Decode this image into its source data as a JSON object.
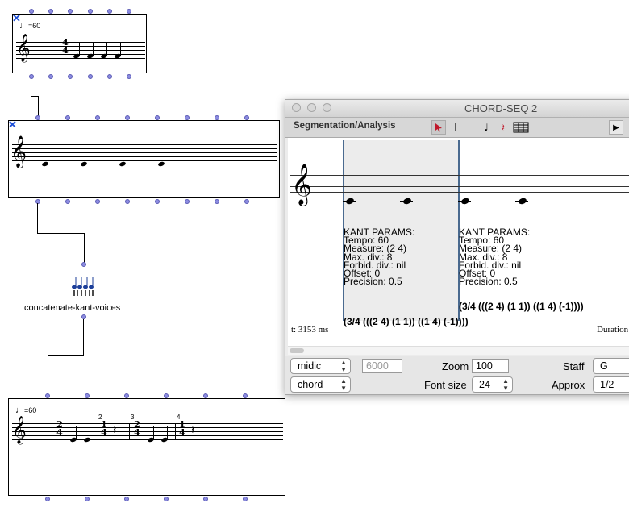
{
  "box1": {
    "tempo_label": "=60",
    "time_sig_top": "4",
    "time_sig_bottom": "4"
  },
  "box4": {
    "tempo_label": "=60",
    "measures": [
      {
        "number": "",
        "top": "2",
        "bottom": "4"
      },
      {
        "number": "2",
        "top": "1",
        "bottom": "4"
      },
      {
        "number": "3",
        "top": "2",
        "bottom": "4"
      },
      {
        "number": "4",
        "top": "1",
        "bottom": "4"
      }
    ]
  },
  "concat_box": {
    "label": "concatenate-kant-voices"
  },
  "window": {
    "title": "CHORD-SEQ 2",
    "toolbar": {
      "segmentation_label": "Segmentation/Analysis"
    },
    "kant_params": [
      {
        "header": "KANT PARAMS:",
        "tempo": "Tempo: 60",
        "measure": "Measure: (2 4)",
        "max_div": "Max. div.: 8",
        "forbid_div": "Forbid. div.: nil",
        "offset": "Offset: 0",
        "precision": "Precision: 0.5",
        "result": "(3/4 (((2 4) (1 1)) ((1 4) (-1))))"
      },
      {
        "header": "KANT PARAMS:",
        "tempo": "Tempo: 60",
        "measure": "Measure: (2 4)",
        "max_div": "Max. div.: 8",
        "forbid_div": "Forbid. div.: nil",
        "offset": "Offset: 0",
        "precision": "Precision: 0.5",
        "result": "(3/4 (((2 4) (1 1)) ((1 4) (-1))))"
      }
    ],
    "time_readout": "t: 3153 ms",
    "duration_label": "Duration",
    "controls": {
      "midic_select": "midic",
      "midic_value": "6000",
      "chord_select": "chord",
      "zoom_label": "Zoom",
      "zoom_value": "100",
      "fontsize_label": "Font size",
      "fontsize_value": "24",
      "staff_label": "Staff",
      "staff_value": "G",
      "approx_label": "Approx",
      "approx_value": "1/2"
    }
  }
}
